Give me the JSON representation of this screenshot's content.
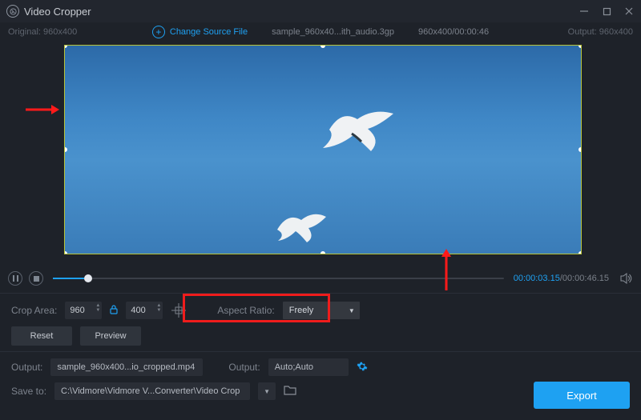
{
  "titlebar": {
    "title": "Video Cropper"
  },
  "header": {
    "original_label": "Original:",
    "original_dims": "960x400",
    "change_source": "Change Source File",
    "filename": "sample_960x40...ith_audio.3gp",
    "srcinfo": "960x400/00:00:46",
    "output_label": "Output:",
    "output_dims": "960x400"
  },
  "playback": {
    "current": "00:00:03.15",
    "total": "/00:00:46.15"
  },
  "crop": {
    "label": "Crop Area:",
    "width": "960",
    "height": "400",
    "aspect_label": "Aspect Ratio:",
    "aspect_value": "Freely",
    "reset": "Reset",
    "preview": "Preview"
  },
  "output": {
    "out_label": "Output:",
    "out_file": "sample_960x400...io_cropped.mp4",
    "out_label2": "Output:",
    "out_setting": "Auto;Auto",
    "saveto_label": "Save to:",
    "saveto_path": "C:\\Vidmore\\Vidmore V...Converter\\Video Crop"
  },
  "export": {
    "label": "Export"
  }
}
